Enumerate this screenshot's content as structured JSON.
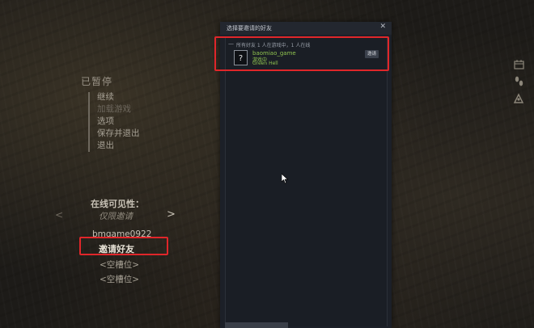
{
  "pause_menu": {
    "title": "已暂停",
    "items": [
      "继续",
      "加载游戏",
      "选项",
      "保存并退出",
      "退出"
    ]
  },
  "visibility": {
    "label": "在线可见性：",
    "value": "仅限邀请",
    "prev": "<",
    "next": ">"
  },
  "lobby": {
    "player_name": "bmgame0922",
    "invite_label": "邀请好友",
    "slots": [
      "<空槽位>",
      "<空槽位>"
    ]
  },
  "dialog": {
    "title": "选择要邀请的好友",
    "close": "✕",
    "group": {
      "toggle": "—",
      "label": "所有好友   1 人在游戏中，1 人在线"
    },
    "friend": {
      "avatar": "?",
      "name": "baomiao_game",
      "status": "游戏中",
      "game": "Green Hell",
      "invite_button": "邀请"
    }
  },
  "side_icons": [
    "calendar-icon",
    "footprints-icon",
    "skills-icon"
  ],
  "colors": {
    "highlight_red": "#e0262a",
    "steam_green": "#8fc24f",
    "steam_bg": "#1c2028"
  }
}
